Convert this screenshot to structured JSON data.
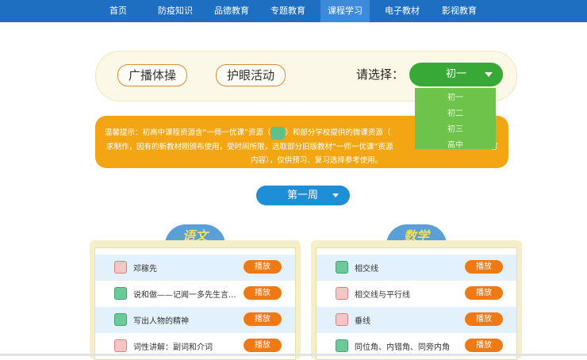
{
  "nav": {
    "items": [
      {
        "label": "首页",
        "active": false
      },
      {
        "label": "防疫知识",
        "active": false
      },
      {
        "label": "品德教育",
        "active": false
      },
      {
        "label": "专题教育",
        "active": false
      },
      {
        "label": "课程学习",
        "active": true
      },
      {
        "label": "电子教材",
        "active": false
      },
      {
        "label": "影视教育",
        "active": false
      }
    ]
  },
  "activities": {
    "broadcast_label": "广播体操",
    "eye_label": "护眼活动"
  },
  "grade_select": {
    "label": "请选择：",
    "value": "初一",
    "options": [
      "初一",
      "初二",
      "初三",
      "高中"
    ]
  },
  "notice": {
    "line1_a": "温馨提示：初高中课程资源含“一师一优课”资源（",
    "line1_b": "）和部分学校提供的微课资源（",
    "line1_c": "要",
    "line2_a": "求制作，因有的新教材刚颁布使用，受时间所限，选取部分旧版教材“一师一优课”资源",
    "line2_b": "容",
    "line3": "内容），仅供预习、复习选择参考使用。"
  },
  "week_select": {
    "value": "第一周"
  },
  "panels": [
    {
      "subject": "语文",
      "rows": [
        {
          "icon": "document-icon",
          "title": "邓稼先",
          "action": "播放"
        },
        {
          "icon": "video-icon",
          "title": "说和做——记闻一多先生言...",
          "action": "播放"
        },
        {
          "icon": "video-icon",
          "title": "写出人物的精神",
          "action": "播放"
        },
        {
          "icon": "document-icon",
          "title": "词性讲解：副词和介词",
          "action": "播放"
        }
      ]
    },
    {
      "subject": "数学",
      "rows": [
        {
          "icon": "video-icon",
          "title": "相交线",
          "action": "播放"
        },
        {
          "icon": "document-icon",
          "title": "相交线与平行线",
          "action": "播放"
        },
        {
          "icon": "document-icon",
          "title": "垂线",
          "action": "播放"
        },
        {
          "icon": "video-icon",
          "title": "同位角、内错角、同旁内角",
          "action": "播放"
        }
      ]
    }
  ],
  "colors": {
    "nav_bg": "#1e6fc2",
    "select_green": "#38a836",
    "notice_orange": "#f3a513",
    "week_blue": "#1e8fd6",
    "play_orange": "#ef7a15"
  }
}
